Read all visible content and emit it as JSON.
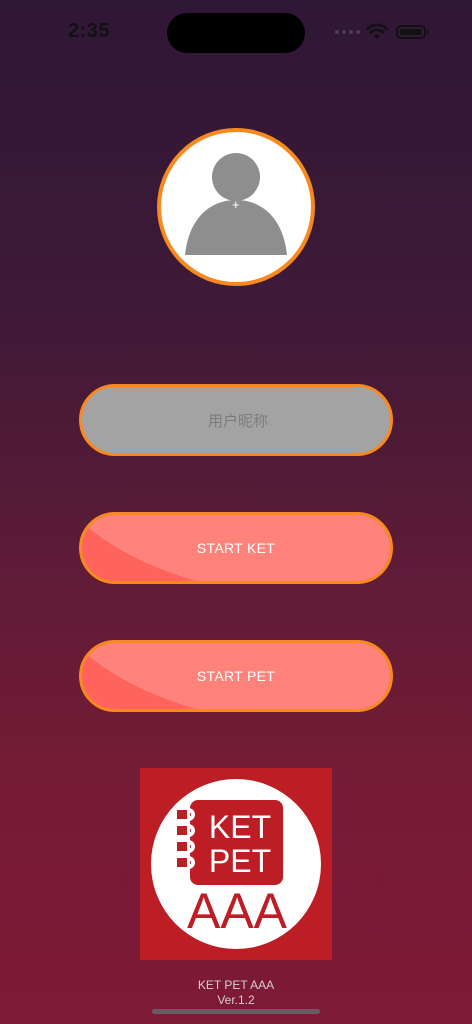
{
  "status_bar": {
    "time": "2:35",
    "icons": [
      "signal-icon",
      "wifi-icon",
      "battery-icon"
    ]
  },
  "avatar": {
    "icon": "person-placeholder-icon",
    "add_symbol": "+"
  },
  "nickname": {
    "placeholder": "用户昵称",
    "value": ""
  },
  "buttons": {
    "start_ket": "START KET",
    "start_pet": "START PET"
  },
  "logo": {
    "line1": "KET",
    "line2": "PET",
    "line3": "AAA"
  },
  "footer": {
    "app_name": "KET PET AAA",
    "version": "Ver.1.2"
  },
  "colors": {
    "accent_border": "#f7891e",
    "button_fill": "#ff645c",
    "input_fill": "#a3a3a3",
    "logo_red": "#bd1d24"
  }
}
